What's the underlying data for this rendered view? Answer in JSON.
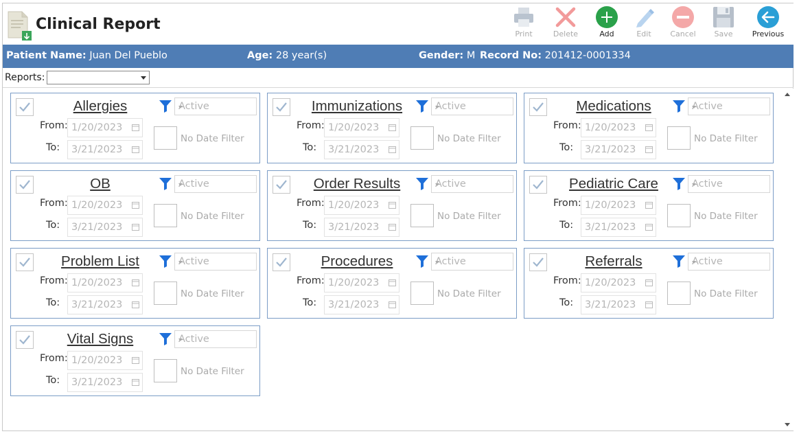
{
  "header": {
    "title": "Clinical Report",
    "toolbar": [
      {
        "name": "print-button",
        "icon": "printer-icon",
        "label": "Print",
        "enabled": false
      },
      {
        "name": "delete-button",
        "icon": "delete-x-icon",
        "label": "Delete",
        "enabled": false
      },
      {
        "name": "add-button",
        "icon": "add-plus-icon",
        "label": "Add",
        "enabled": true
      },
      {
        "name": "edit-button",
        "icon": "pencil-icon",
        "label": "Edit",
        "enabled": false
      },
      {
        "name": "cancel-button",
        "icon": "cancel-icon",
        "label": "Cancel",
        "enabled": false
      },
      {
        "name": "save-button",
        "icon": "floppy-disk-icon",
        "label": "Save",
        "enabled": false
      },
      {
        "name": "previous-button",
        "icon": "arrow-left-icon",
        "label": "Previous",
        "enabled": true
      }
    ]
  },
  "patient": {
    "name_label": "Patient Name:",
    "name": "Juan Del Pueblo",
    "age_label": "Age:",
    "age": "28 year(s)",
    "gender_label": "Gender:",
    "gender": "M",
    "record_label": "Record No:",
    "record": "201412-0001334"
  },
  "reports": {
    "label": "Reports:",
    "selected": ""
  },
  "cards": [
    {
      "title": "Allergies",
      "status": "Active",
      "from_label": "From:",
      "from": "1/20/2023",
      "to_label": "To:",
      "to": "3/21/2023",
      "no_date_label": "No Date Filter"
    },
    {
      "title": "Immunizations",
      "status": "Active",
      "from_label": "From:",
      "from": "1/20/2023",
      "to_label": "To:",
      "to": "3/21/2023",
      "no_date_label": "No Date Filter"
    },
    {
      "title": "Medications",
      "status": "Active",
      "from_label": "From:",
      "from": "1/20/2023",
      "to_label": "To:",
      "to": "3/21/2023",
      "no_date_label": "No Date Filter"
    },
    {
      "title": "OB",
      "status": "Active",
      "from_label": "From:",
      "from": "1/20/2023",
      "to_label": "To:",
      "to": "3/21/2023",
      "no_date_label": "No Date Filter"
    },
    {
      "title": "Order Results",
      "status": "Active",
      "from_label": "From:",
      "from": "1/20/2023",
      "to_label": "To:",
      "to": "3/21/2023",
      "no_date_label": "No Date Filter"
    },
    {
      "title": "Pediatric Care",
      "status": "Active",
      "from_label": "From:",
      "from": "1/20/2023",
      "to_label": "To:",
      "to": "3/21/2023",
      "no_date_label": "No Date Filter"
    },
    {
      "title": "Problem List",
      "status": "Active",
      "from_label": "From:",
      "from": "1/20/2023",
      "to_label": "To:",
      "to": "3/21/2023",
      "no_date_label": "No Date Filter"
    },
    {
      "title": "Procedures",
      "status": "Active",
      "from_label": "From:",
      "from": "1/20/2023",
      "to_label": "To:",
      "to": "3/21/2023",
      "no_date_label": "No Date Filter"
    },
    {
      "title": "Referrals",
      "status": "Active",
      "from_label": "From:",
      "from": "1/20/2023",
      "to_label": "To:",
      "to": "3/21/2023",
      "no_date_label": "No Date Filter"
    },
    {
      "title": "Vital Signs",
      "status": "Active",
      "from_label": "From:",
      "from": "1/20/2023",
      "to_label": "To:",
      "to": "3/21/2023",
      "no_date_label": "No Date Filter"
    }
  ],
  "colors": {
    "patient_bar": "#4f7db5",
    "card_border": "#7a9cc6",
    "filter_icon": "#1e6fd9",
    "add_green": "#2aa14a",
    "previous_teal": "#2a9fd6",
    "delete_red": "#f08c8c"
  }
}
